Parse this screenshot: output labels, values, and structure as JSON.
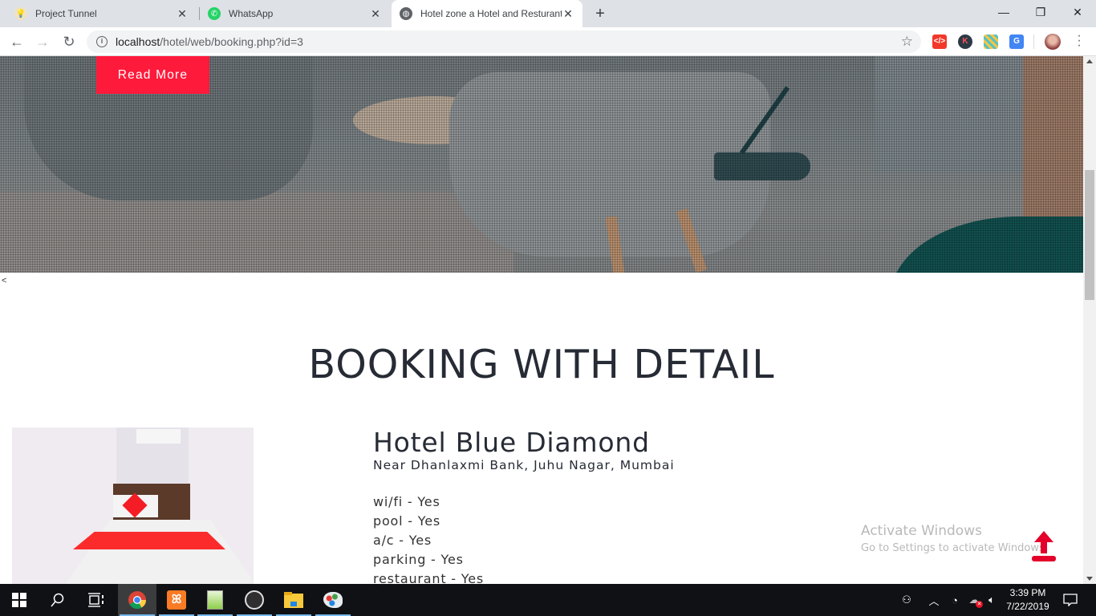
{
  "browser": {
    "tabs": [
      {
        "title": "Project Tunnel",
        "icon": "lightbulb-icon",
        "active": false
      },
      {
        "title": "WhatsApp",
        "icon": "whatsapp-icon",
        "active": false
      },
      {
        "title": "Hotel zone a Hotel and Resturant",
        "icon": "globe-icon",
        "active": true
      }
    ],
    "new_tab_label": "+",
    "window_controls": {
      "minimize": "—",
      "restore": "❐",
      "close": "✕"
    },
    "nav": {
      "back": "←",
      "forward": "→",
      "reload": "↻"
    },
    "url": {
      "host": "localhost",
      "path": "/hotel/web/booking.php?id=3"
    },
    "bookmark_icon": "☆",
    "extensions": [
      {
        "name": "code-extension-icon",
        "label": "</>",
        "color": "#f2382a"
      },
      {
        "name": "k-extension-icon",
        "label": "K",
        "color": "#2c3a47"
      },
      {
        "name": "grid-extension-icon",
        "label": "",
        "color": "#f6c445"
      },
      {
        "name": "google-translate-icon",
        "label": "G",
        "color": "#4285f4"
      }
    ]
  },
  "page": {
    "hero": {
      "read_more_label": "Read More"
    },
    "stray_char": "<",
    "section_title": "BOOKING WITH DETAIL",
    "hotel": {
      "name": "Hotel Blue Diamond",
      "address": "Near Dhanlaxmi Bank, Juhu Nagar, Mumbai",
      "amenities": [
        {
          "name": "wi/fi",
          "value": "Yes"
        },
        {
          "name": "pool",
          "value": "Yes"
        },
        {
          "name": "a/c",
          "value": "Yes"
        },
        {
          "name": "parking",
          "value": "Yes"
        },
        {
          "name": "restaurant",
          "value": "Yes"
        }
      ]
    },
    "accent_color": "#fe1a3b",
    "scroll_top_icon": "arrow-up-icon"
  },
  "watermark": {
    "line1": "Activate Windows",
    "line2": "Go to Settings to activate Windows."
  },
  "taskbar": {
    "apps": [
      "chrome",
      "xampp",
      "notepad++",
      "obs",
      "file-explorer",
      "paint"
    ],
    "time": "3:39 PM",
    "date": "7/22/2019"
  }
}
